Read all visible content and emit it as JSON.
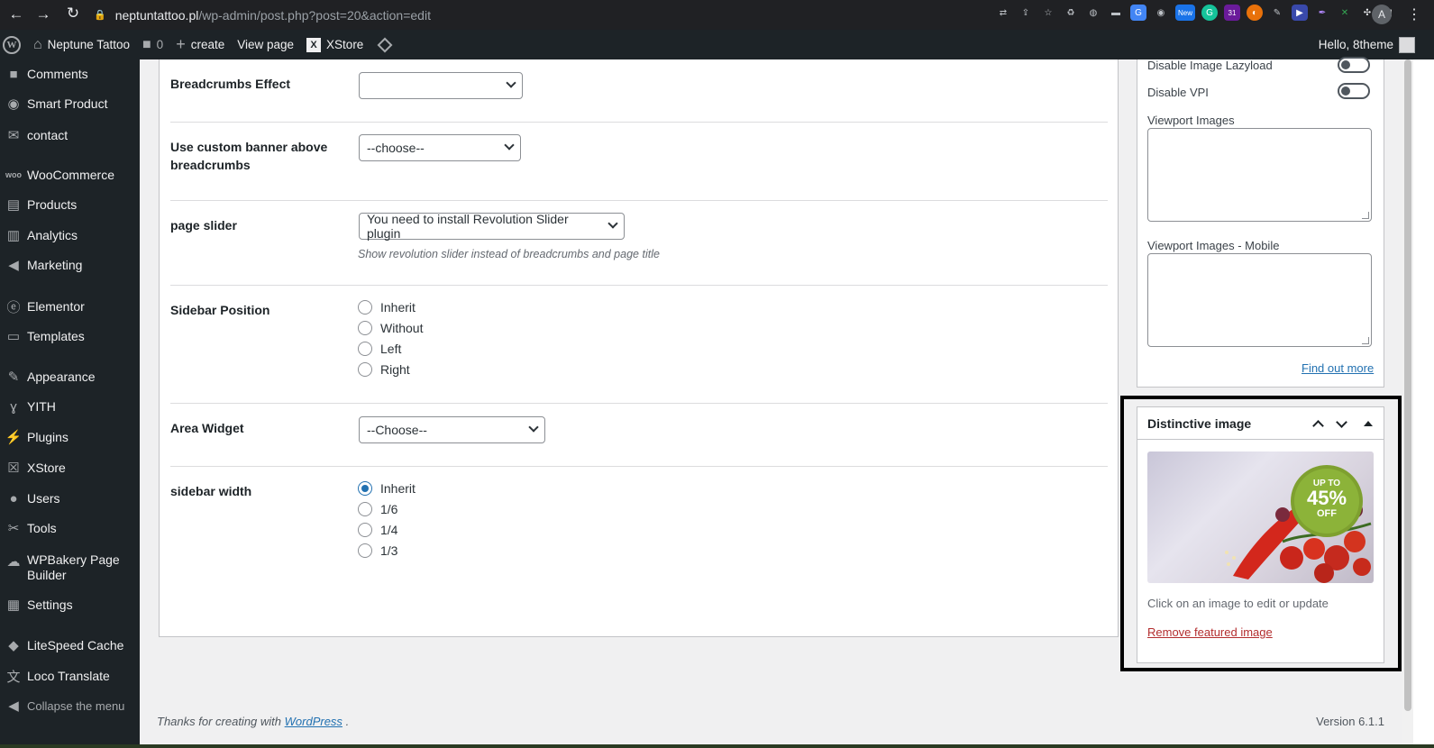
{
  "browser": {
    "url_host": "neptuntattoo.pl",
    "url_path": "/wp-admin/post.php?post=20&action=edit",
    "profile_initial": "A",
    "new_badge": "New",
    "calendar_badge": "31"
  },
  "admin_bar": {
    "site_name": "Neptune Tattoo",
    "comments_count": "0",
    "create_label": "create",
    "view_page_label": "View page",
    "xstore_label": "XStore",
    "greeting": "Hello, 8theme"
  },
  "sidebar": {
    "items": [
      {
        "label": "Comments",
        "icon": "comment-icon"
      },
      {
        "label": "Smart Product",
        "icon": "eye-icon"
      },
      {
        "label": "contact",
        "icon": "mail-icon"
      },
      {
        "label": "WooCommerce",
        "icon": "woo-icon"
      },
      {
        "label": "Products",
        "icon": "archive-icon"
      },
      {
        "label": "Analytics",
        "icon": "bar-chart-icon"
      },
      {
        "label": "Marketing",
        "icon": "megaphone-icon"
      },
      {
        "label": "Elementor",
        "icon": "elementor-icon"
      },
      {
        "label": "Templates",
        "icon": "folder-icon"
      },
      {
        "label": "Appearance",
        "icon": "brush-icon"
      },
      {
        "label": "YITH",
        "icon": "yith-icon"
      },
      {
        "label": "Plugins",
        "icon": "plug-icon"
      },
      {
        "label": "XStore",
        "icon": "xstore-icon"
      },
      {
        "label": "Users",
        "icon": "user-icon"
      },
      {
        "label": "Tools",
        "icon": "wrench-icon"
      },
      {
        "label": "WPBakery Page Builder",
        "icon": "cloud-icon"
      },
      {
        "label": "Settings",
        "icon": "settings-icon"
      },
      {
        "label": "LiteSpeed Cache",
        "icon": "diamond-icon"
      },
      {
        "label": "Loco Translate",
        "icon": "translate-icon"
      },
      {
        "label": "Collapse the menu",
        "icon": "collapse-icon"
      }
    ]
  },
  "form": {
    "breadcrumbs_effect": {
      "label": "Breadcrumbs Effect",
      "value": ""
    },
    "custom_banner": {
      "label": "Use custom banner above breadcrumbs",
      "value": "--choose--"
    },
    "page_slider": {
      "label": "page slider",
      "value": "You need to install Revolution Slider plugin",
      "help": "Show revolution slider instead of breadcrumbs and page title"
    },
    "sidebar_position": {
      "label": "Sidebar Position",
      "options": [
        "Inherit",
        "Without",
        "Left",
        "Right"
      ],
      "selected": ""
    },
    "area_widget": {
      "label": "Area Widget",
      "value": "--Choose--"
    },
    "sidebar_width": {
      "label": "sidebar width",
      "options": [
        "Inherit",
        "1/6",
        "1/4",
        "1/3"
      ],
      "selected": "Inherit"
    }
  },
  "side_panel": {
    "disable_lazyload_label": "Disable Image Lazyload",
    "disable_vpi_label": "Disable VPI",
    "viewport_images_label": "Viewport Images",
    "viewport_images_mobile_label": "Viewport Images - Mobile",
    "find_out_more": "Find out more"
  },
  "featured_image": {
    "title": "Distinctive image",
    "badge_line1": "UP TO",
    "badge_line2": "45%",
    "badge_line3": "OFF",
    "caption": "Click on an image to edit or update",
    "remove_label": "Remove featured image"
  },
  "footer": {
    "thanks_prefix": "Thanks for creating with",
    "wp_link": "WordPress",
    "thanks_suffix": ".",
    "version": "Version 6.1.1"
  }
}
